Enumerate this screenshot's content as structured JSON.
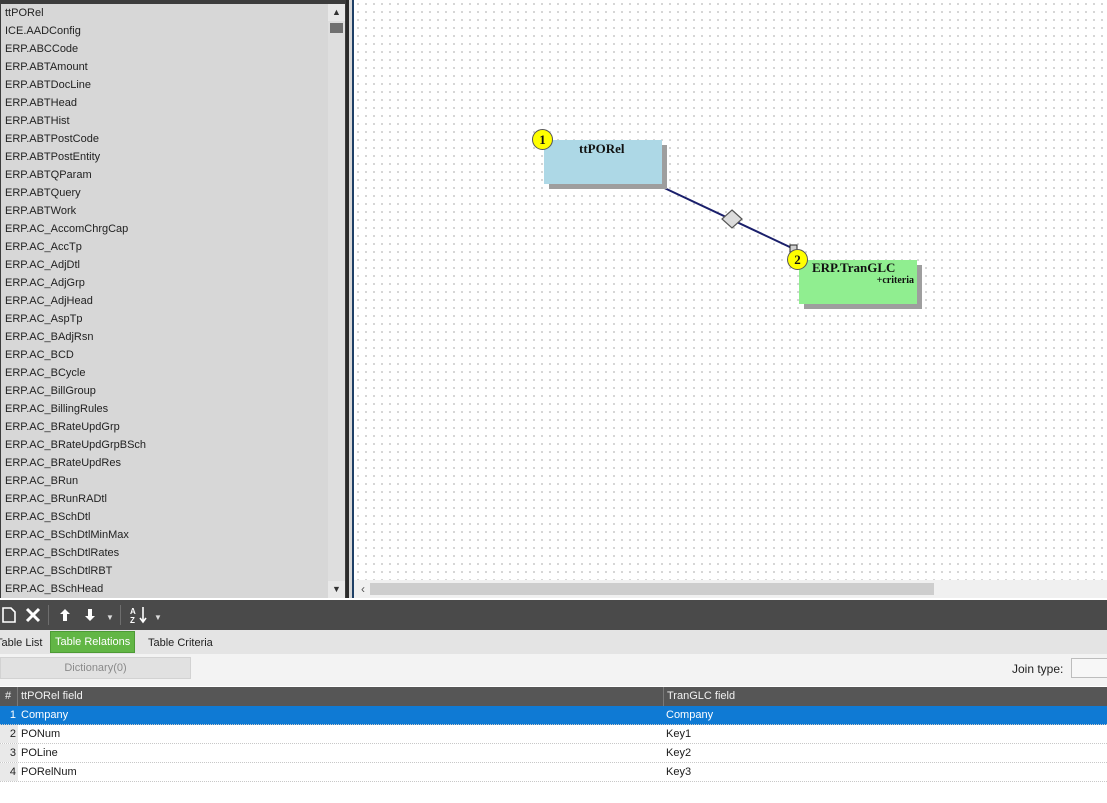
{
  "table_list": {
    "items": [
      "ttPORel",
      "ICE.AADConfig",
      "ERP.ABCCode",
      "ERP.ABTAmount",
      "ERP.ABTDocLine",
      "ERP.ABTHead",
      "ERP.ABTHist",
      "ERP.ABTPostCode",
      "ERP.ABTPostEntity",
      "ERP.ABTQParam",
      "ERP.ABTQuery",
      "ERP.ABTWork",
      "ERP.AC_AccomChrgCap",
      "ERP.AC_AccTp",
      "ERP.AC_AdjDtl",
      "ERP.AC_AdjGrp",
      "ERP.AC_AdjHead",
      "ERP.AC_AspTp",
      "ERP.AC_BAdjRsn",
      "ERP.AC_BCD",
      "ERP.AC_BCycle",
      "ERP.AC_BillGroup",
      "ERP.AC_BillingRules",
      "ERP.AC_BRateUpdGrp",
      "ERP.AC_BRateUpdGrpBSch",
      "ERP.AC_BRateUpdRes",
      "ERP.AC_BRun",
      "ERP.AC_BRunRADtl",
      "ERP.AC_BSchDtl",
      "ERP.AC_BSchDtlMinMax",
      "ERP.AC_BSchDtlRates",
      "ERP.AC_BSchDtlRBT",
      "ERP.AC_BSchHead"
    ]
  },
  "diagram": {
    "node1": {
      "badge": "1",
      "title": "ttPORel",
      "color": "#add8e6"
    },
    "node2": {
      "badge": "2",
      "title": "ERP.TranGLC",
      "subtitle": "+criteria",
      "color": "#90ee90"
    },
    "link_color": "#1a1f6b"
  },
  "tabs": [
    {
      "label": "Table List",
      "active": false
    },
    {
      "label": "Table Relations",
      "active": true
    },
    {
      "label": "Table Criteria",
      "active": false
    }
  ],
  "options": {
    "dictionary_label": "Dictionary(0)",
    "join_type_label": "Join type:",
    "join_type_value": ""
  },
  "grid": {
    "columns": [
      "#",
      "ttPORel field",
      "TranGLC field"
    ],
    "rows": [
      {
        "num": "1",
        "left": "Company",
        "right": "Company",
        "selected": true
      },
      {
        "num": "2",
        "left": "PONum",
        "right": "Key1",
        "selected": false
      },
      {
        "num": "3",
        "left": "POLine",
        "right": "Key2",
        "selected": false
      },
      {
        "num": "4",
        "left": "PORelNum",
        "right": "Key3",
        "selected": false
      }
    ]
  },
  "toolbar": {
    "icons": [
      "new-icon",
      "delete-icon",
      "move-up-icon",
      "move-down-icon",
      "sort-icon"
    ]
  },
  "colors": {
    "accent_tab": "#62b645",
    "selected_row": "#0f7ad4"
  }
}
